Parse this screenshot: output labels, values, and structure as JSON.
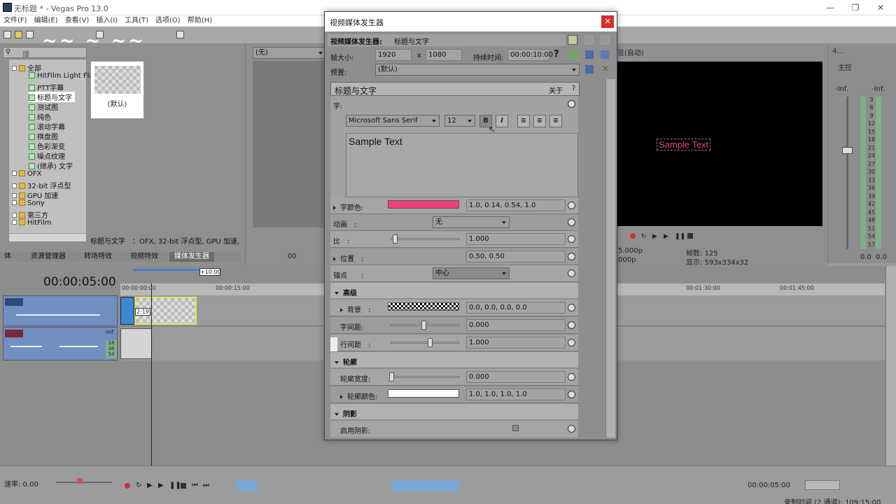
{
  "window": {
    "title": "无标题 * - Vegas Pro 13.0"
  },
  "menu": [
    "文件(F)",
    "编辑(E)",
    "查看(V)",
    "插入(I)",
    "工具(T)",
    "选项(O)",
    "帮助(H)"
  ],
  "explorer": {
    "search_placeholder": "搜",
    "tree": [
      {
        "label": "全部",
        "type": "folder",
        "level": 0
      },
      {
        "label": "HitFilm Light Flar",
        "type": "gen",
        "level": 1
      },
      {
        "label": "PTT字幕",
        "type": "gen",
        "level": 1
      },
      {
        "label": "标题与文字",
        "type": "gen",
        "level": 1,
        "selected": true
      },
      {
        "label": "测试图",
        "type": "gen",
        "level": 1
      },
      {
        "label": "纯色",
        "type": "gen",
        "level": 1
      },
      {
        "label": "滚动字幕",
        "type": "gen",
        "level": 1
      },
      {
        "label": "棋盘图",
        "type": "gen",
        "level": 1
      },
      {
        "label": "色彩渐变",
        "type": "gen",
        "level": 1
      },
      {
        "label": "噪点纹理",
        "type": "gen",
        "level": 1
      },
      {
        "label": "(继承) 文字",
        "type": "gen",
        "level": 1
      },
      {
        "label": "OFX",
        "type": "folder",
        "level": 0
      },
      {
        "label": "32-bit 浮点型",
        "type": "folder",
        "level": 0
      },
      {
        "label": "GPU 加速",
        "type": "folder",
        "level": 0
      },
      {
        "label": "Sony",
        "type": "folder",
        "level": 0
      },
      {
        "label": "第三方",
        "type": "folder",
        "level": 0
      },
      {
        "label": "HitFilm",
        "type": "folder",
        "level": 0
      }
    ],
    "preset_label": "(默认)",
    "status": "标题与文字　：OFX, 32-bit 浮点型, GPU 加速, 分",
    "tabs": [
      "体",
      "资源管理器",
      "转场特效",
      "视频特效",
      "媒体发生器"
    ]
  },
  "trimmer": {
    "selector": "(无)",
    "time": "00"
  },
  "preview": {
    "quality": "览(自动)",
    "sample_text": "Sample Text",
    "info_left1": "5.000p",
    "info_left2": "000p",
    "frame": "帧数: 125",
    "display": "显示: 593x334x32"
  },
  "master": {
    "title": "主控",
    "ch": "4...",
    "inf_l": "-Inf.",
    "inf_r": "-Inf.",
    "scale": [
      "3",
      "6",
      "9",
      "12",
      "15",
      "18",
      "21",
      "24",
      "27",
      "30",
      "33",
      "36",
      "39",
      "42",
      "45",
      "48",
      "51",
      "54",
      "57"
    ],
    "bottom_l": "0.0",
    "bottom_r": "0.0"
  },
  "timeline": {
    "timecode": "00:00:05:00",
    "marker": "+10:00",
    "ruler": [
      "00:00:00:00",
      "00:00:15:00",
      "00:01:30:00",
      "00:01:45:00"
    ],
    "clip_label": "2:19",
    "audio_inf": "-Inf.",
    "audio_nums": [
      "18",
      "36",
      "54"
    ]
  },
  "status": {
    "rate": "速率: 0.00",
    "time": "00:00:05:00",
    "record": "录制时间 (2 通道): 109:15:00"
  },
  "dialog": {
    "title": "视频媒体发生器",
    "header_label": "视频媒体发生器:",
    "header_value": "标题与文字",
    "frame_size_label": "帧大小:",
    "width": "1920",
    "x": "x",
    "height": "1080",
    "duration_label": "持续时间:",
    "duration": "00:00:10:00",
    "help": "?",
    "preset_label": "预置:",
    "preset_value": "(默认)",
    "plugin_title": "标题与文字",
    "about": "关于",
    "about_help": "?",
    "font_label": "字:",
    "font_name": "Microsoft Sans Serif",
    "font_size": "12",
    "bold": "B",
    "italic": "I",
    "text": "Sample Text",
    "text_color_label": "字颜色:",
    "text_color": "#f0407c",
    "text_color_value": "1.0, 0.14, 0.54, 1.0",
    "animation_label": "动画　:",
    "animation_value": "无",
    "scale_label": "比　:",
    "scale_value": "1.000",
    "position_label": "位置　:",
    "position_value": "0.50, 0.50",
    "anchor_label": "锚点　　:",
    "anchor_value": "中心",
    "advanced": "高级",
    "background_label": "背景　:",
    "background_value": "0.0, 0.0, 0.0, 0.0",
    "tracking_label": "字间距:",
    "tracking_value": "0.000",
    "line_spacing_label": "行间距　:",
    "line_spacing_value": "1.000",
    "outline": "轮廓",
    "outline_width_label": "轮廓宽度:",
    "outline_width_value": "0.000",
    "outline_color_label": "轮廓颜色:",
    "outline_color_value": "1.0, 1.0, 1.0, 1.0",
    "shadow": "阴影",
    "enable_shadow_label": "启用阴影:",
    "scale_level": 0.05,
    "tracking_level": 0.5,
    "line_spacing_level": 0.6,
    "outline_width_level": 0.0
  }
}
